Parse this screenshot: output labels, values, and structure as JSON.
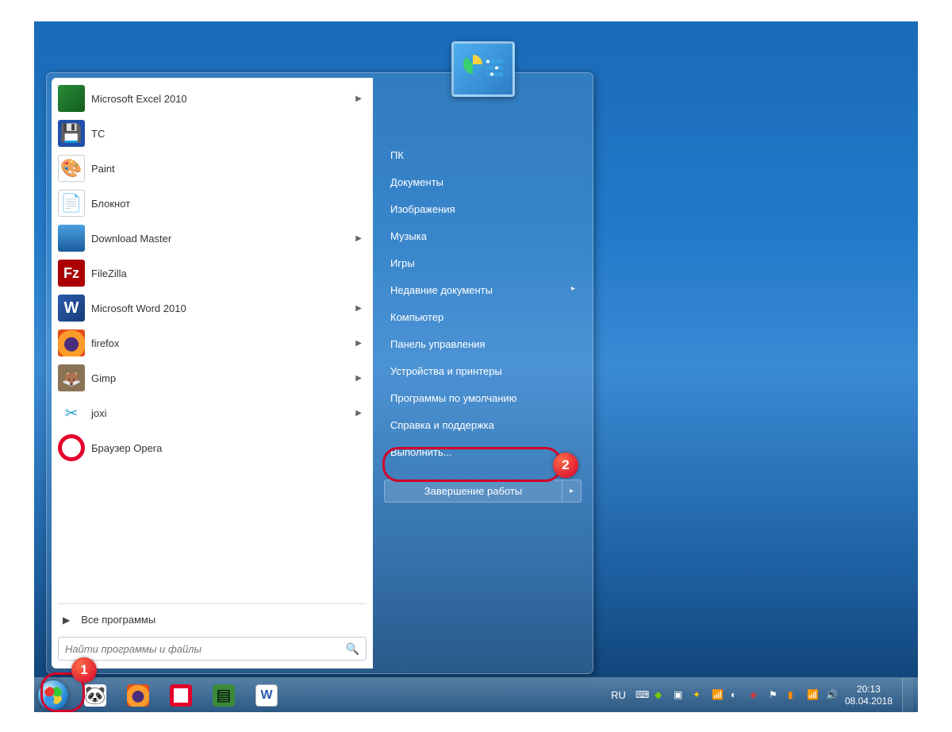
{
  "programs": [
    {
      "label": "Microsoft Excel 2010",
      "icon": "i-excel",
      "arrow": true
    },
    {
      "label": "TC",
      "icon": "i-tc",
      "arrow": false
    },
    {
      "label": "Paint",
      "icon": "i-paint",
      "arrow": false
    },
    {
      "label": "Блокнот",
      "icon": "i-note",
      "arrow": false
    },
    {
      "label": "Download Master",
      "icon": "i-dm",
      "arrow": true
    },
    {
      "label": "FileZilla",
      "icon": "i-fz",
      "arrow": false
    },
    {
      "label": "Microsoft Word 2010",
      "icon": "i-word",
      "arrow": true
    },
    {
      "label": "firefox",
      "icon": "i-ff",
      "arrow": true
    },
    {
      "label": "Gimp",
      "icon": "i-gimp",
      "arrow": true
    },
    {
      "label": "joxi",
      "icon": "i-joxi",
      "arrow": true
    },
    {
      "label": "Браузер Opera",
      "icon": "i-opera",
      "arrow": false
    }
  ],
  "all_programs": "Все программы",
  "search_placeholder": "Найти программы и файлы",
  "right_items": [
    {
      "label": "ПК",
      "sub": false
    },
    {
      "label": "Документы",
      "sub": false
    },
    {
      "label": "Изображения",
      "sub": false
    },
    {
      "label": "Музыка",
      "sub": false
    },
    {
      "label": "Игры",
      "sub": false
    },
    {
      "label": "Недавние документы",
      "sub": true
    },
    {
      "label": "Компьютер",
      "sub": false
    },
    {
      "label": "Панель управления",
      "sub": false
    },
    {
      "label": "Устройства и принтеры",
      "sub": false
    },
    {
      "label": "Программы по умолчанию",
      "sub": false
    },
    {
      "label": "Справка и поддержка",
      "sub": false
    },
    {
      "label": "Выполнить...",
      "sub": false
    }
  ],
  "shutdown": "Завершение работы",
  "taskbar_icons": [
    "i-panda",
    "i-ff",
    "i-opera",
    "i-lib",
    "i-word-tb"
  ],
  "tray": {
    "lang": "RU",
    "time": "20:13",
    "date": "08.04.2018"
  },
  "callouts": {
    "c1": "1",
    "c2": "2"
  }
}
